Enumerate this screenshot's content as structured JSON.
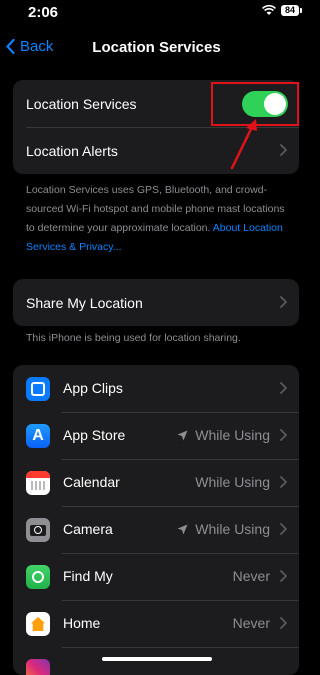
{
  "status_bar": {
    "time": "2:06",
    "battery": "84"
  },
  "nav": {
    "back_label": "Back",
    "title": "Location Services"
  },
  "main_group": {
    "location_services_label": "Location Services",
    "location_services_on": true,
    "location_alerts_label": "Location Alerts"
  },
  "footnote1": {
    "text": "Location Services uses GPS, Bluetooth, and crowd-sourced Wi-Fi hotspot and mobile phone mast locations to determine your approximate location.",
    "link": "About Location Services & Privacy..."
  },
  "share_group": {
    "label": "Share My Location"
  },
  "footnote2": {
    "text": "This iPhone is being used for location sharing."
  },
  "apps": [
    {
      "name": "App Clips",
      "value": "",
      "icon": "app-clips-icon",
      "arrow": false
    },
    {
      "name": "App Store",
      "value": "While Using",
      "icon": "app-store-icon",
      "arrow": true
    },
    {
      "name": "Calendar",
      "value": "While Using",
      "icon": "calendar-icon",
      "arrow": false
    },
    {
      "name": "Camera",
      "value": "While Using",
      "icon": "camera-icon",
      "arrow": true
    },
    {
      "name": "Find My",
      "value": "Never",
      "icon": "find-my-icon",
      "arrow": false
    },
    {
      "name": "Home",
      "value": "Never",
      "icon": "home-icon",
      "arrow": false
    }
  ],
  "colors": {
    "accent": "#0a84ff",
    "toggle_on": "#30d158",
    "highlight": "#e0131b"
  }
}
